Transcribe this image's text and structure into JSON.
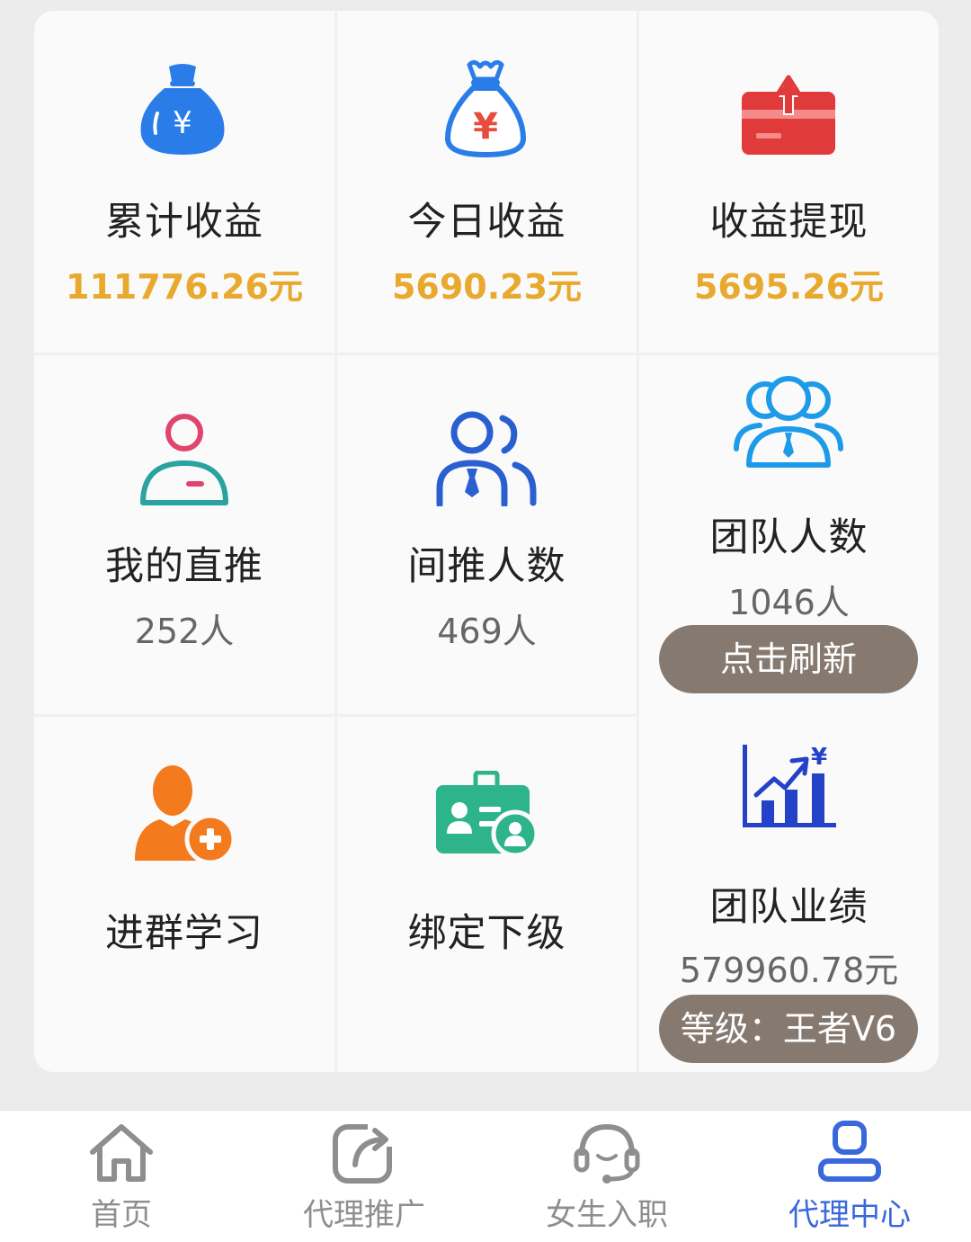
{
  "stats": {
    "total_earnings": {
      "label": "累计收益",
      "value": "111776.26元",
      "icon": "money-bag-icon"
    },
    "today_earnings": {
      "label": "今日收益",
      "value": "5690.23元",
      "icon": "yuan-bag-icon"
    },
    "withdraw": {
      "label": "收益提现",
      "value": "5695.26元",
      "icon": "withdraw-card-icon"
    },
    "direct_referrals": {
      "label": "我的直推",
      "value": "252人",
      "icon": "user-icon"
    },
    "indirect_referrals": {
      "label": "间推人数",
      "value": "469人",
      "icon": "users-icon"
    },
    "team_size": {
      "label": "团队人数",
      "value": "1046人",
      "icon": "team-icon",
      "button": "点击刷新"
    },
    "join_group": {
      "label": "进群学习",
      "icon": "add-user-icon"
    },
    "bind_subordinate": {
      "label": "绑定下级",
      "icon": "id-card-icon"
    },
    "team_performance": {
      "label": "团队业绩",
      "value": "579960.78元",
      "icon": "growth-chart-icon",
      "level": "等级：王者V6"
    }
  },
  "tabbar": [
    {
      "label": "首页",
      "icon": "home-icon",
      "active": false
    },
    {
      "label": "代理推广",
      "icon": "share-icon",
      "active": false
    },
    {
      "label": "女生入职",
      "icon": "headset-icon",
      "active": false
    },
    {
      "label": "代理中心",
      "icon": "user-center-icon",
      "active": true
    }
  ],
  "colors": {
    "gold": "#e8a92e",
    "pill": "#867a70",
    "active_tab": "#3a68dc",
    "inactive_tab": "#8e8e8e"
  }
}
